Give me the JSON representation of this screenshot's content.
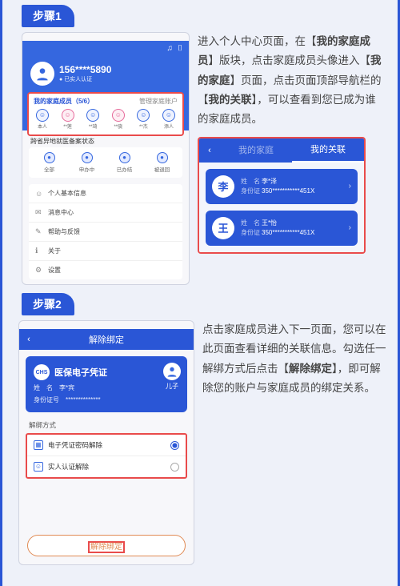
{
  "steps": {
    "step1_label": "步骤1",
    "step2_label": "步骤2"
  },
  "step1": {
    "explain_html": "进入个人中心页面，在【我的家庭成员】版块，点击家庭成员头像进入【我的家庭】页面，点击页面顶部导航栏的【我的关联】，可以查看到您已成为谁的家庭成员。",
    "phone": {
      "phone_masked": "156****5890",
      "verified": "已实人认证",
      "family_title": "我的家庭成员（5/6）",
      "family_manage": "管理家庭账户",
      "members": [
        {
          "label": "本人",
          "style": "blue"
        },
        {
          "label": "**莲",
          "style": "pink"
        },
        {
          "label": "**琦",
          "style": "blue"
        },
        {
          "label": "**骁",
          "style": "pink"
        },
        {
          "label": "**杰",
          "style": "blue"
        },
        {
          "label": "添人",
          "style": "blue"
        }
      ],
      "section_title": "跨省异地就医备案状态",
      "tabs": [
        {
          "label": "全部"
        },
        {
          "label": "申办中"
        },
        {
          "label": "已办结"
        },
        {
          "label": "被退回"
        }
      ],
      "list": [
        {
          "icon": "☺",
          "label": "个人基本信息"
        },
        {
          "icon": "✉",
          "label": "消息中心"
        },
        {
          "icon": "✎",
          "label": "帮助与反馈"
        },
        {
          "icon": "ℹ",
          "label": "关于"
        },
        {
          "icon": "⚙",
          "label": "设置"
        }
      ]
    },
    "assoc": {
      "tab_family": "我的家庭",
      "tab_assoc": "我的关联",
      "items": [
        {
          "badge": "李",
          "name_label": "姓　名",
          "name": "李*泽",
          "id_label": "身份证",
          "id": "350***********451X"
        },
        {
          "badge": "王",
          "name_label": "姓　名",
          "name": "王*怡",
          "id_label": "身份证",
          "id": "350***********451X"
        }
      ]
    }
  },
  "step2": {
    "explain_html": "点击家庭成员进入下一页面，您可以在此页面查看详细的关联信息。勾选任一解绑方式后点击【解除绑定】，即可解除您的账户与家庭成员的绑定关系。",
    "phone": {
      "nav_title": "解除绑定",
      "card_title": "医保电子凭证",
      "card_name_label": "姓　名",
      "card_name": "李*宾",
      "card_id_label": "身份证号",
      "card_id": "**************",
      "child_label": "儿子",
      "opt_title": "解绑方式",
      "options": [
        {
          "icon": "▦",
          "label": "电子凭证密码解除",
          "checked": true
        },
        {
          "icon": "☺",
          "label": "实人认证解除",
          "checked": false
        }
      ],
      "button": "解除绑定"
    }
  }
}
